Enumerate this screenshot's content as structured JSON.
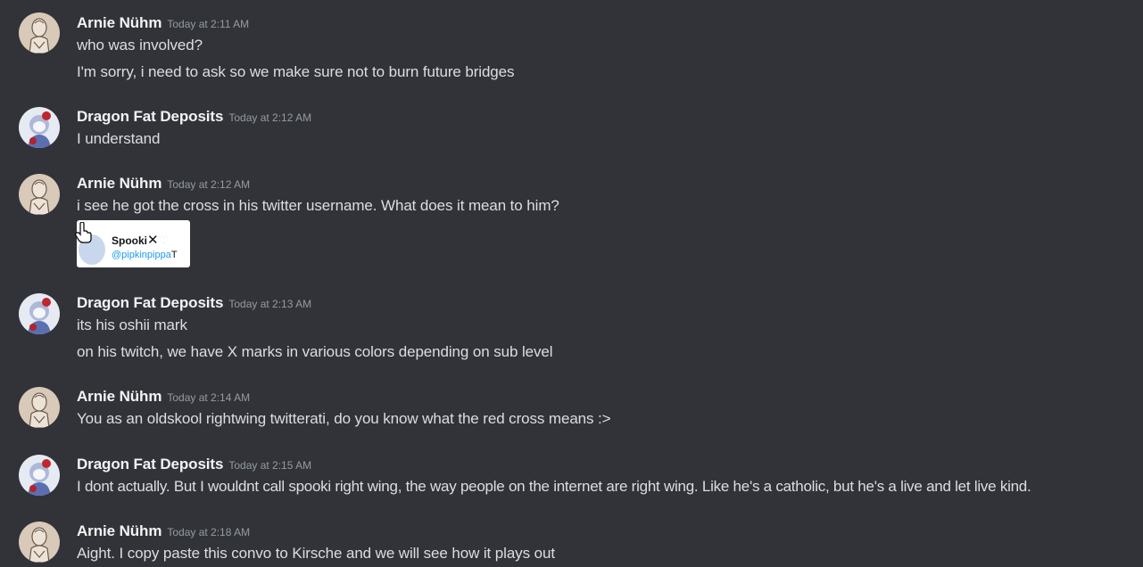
{
  "messages": [
    {
      "author": "Arnie Nühm",
      "time": "Today at 2:11 AM",
      "avatar": "arnie-avatar",
      "lines": [
        "who was involved?",
        "I'm sorry, i need to ask so we make sure not to burn future bridges"
      ]
    },
    {
      "author": "Dragon Fat Deposits",
      "time": "Today at 2:12 AM",
      "avatar": "dragon-avatar",
      "lines": [
        "I understand"
      ]
    },
    {
      "author": "Arnie Nühm",
      "time": "Today at 2:12 AM",
      "avatar": "arnie-avatar",
      "lines": [
        "i see he got the cross in his twitter username. What does it mean to him?"
      ],
      "embed": {
        "name": "Spooki",
        "name_symbol": "✕",
        "heart": "♡",
        "handle": "@pipkinpippa",
        "trailing": "T"
      }
    },
    {
      "author": "Dragon Fat Deposits",
      "time": "Today at 2:13 AM",
      "avatar": "dragon-avatar",
      "lines": [
        "its his oshii mark",
        "on his twitch, we have X marks in various colors depending on sub level"
      ]
    },
    {
      "author": "Arnie Nühm",
      "time": "Today at 2:14 AM",
      "avatar": "arnie-avatar",
      "lines": [
        "You as an oldskool rightwing twitterati, do you know what the red cross means :>"
      ]
    },
    {
      "author": "Dragon Fat Deposits",
      "time": "Today at 2:15 AM",
      "avatar": "dragon-avatar",
      "lines": [
        "I dont actually. But I wouldnt call spooki right wing, the way people on the internet are right wing. Like he's a catholic, but he's a live and let live kind."
      ]
    },
    {
      "author": "Arnie Nühm",
      "time": "Today at 2:18 AM",
      "avatar": "arnie-avatar",
      "lines": [
        "Aight. I copy paste this convo to Kirsche and we will see how it plays out"
      ]
    }
  ],
  "colors": {
    "background": "#313338",
    "username": "#f2f3f5",
    "text": "#dbdee1",
    "timestamp": "#949ba4",
    "twitter_blue": "#1d9bf0"
  }
}
